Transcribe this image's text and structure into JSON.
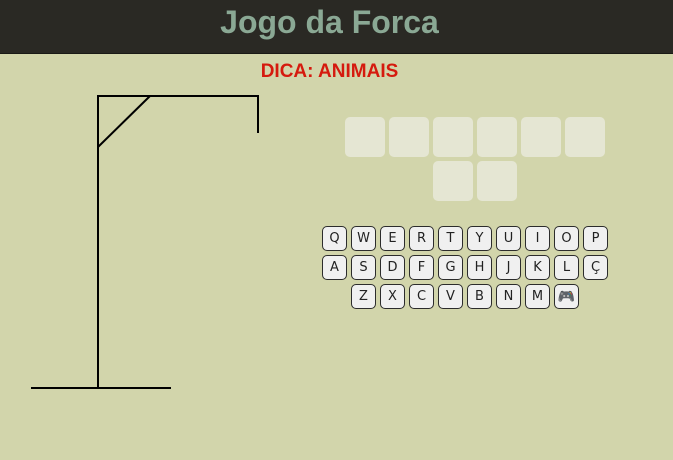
{
  "header": {
    "title": "Jogo da Forca"
  },
  "hint": {
    "text": "DICA: ANIMAIS"
  },
  "word": {
    "slots": [
      "",
      "",
      "",
      "",
      "",
      "",
      "",
      ""
    ]
  },
  "keyboard": {
    "rows": [
      [
        "Q",
        "W",
        "E",
        "R",
        "T",
        "Y",
        "U",
        "I",
        "O",
        "P"
      ],
      [
        "A",
        "S",
        "D",
        "F",
        "G",
        "H",
        "J",
        "K",
        "L",
        "Ç"
      ],
      [
        "Z",
        "X",
        "C",
        "V",
        "B",
        "N",
        "M"
      ]
    ],
    "extra_key_icon": "🎮",
    "extra_key_name": "gamepad-icon"
  }
}
